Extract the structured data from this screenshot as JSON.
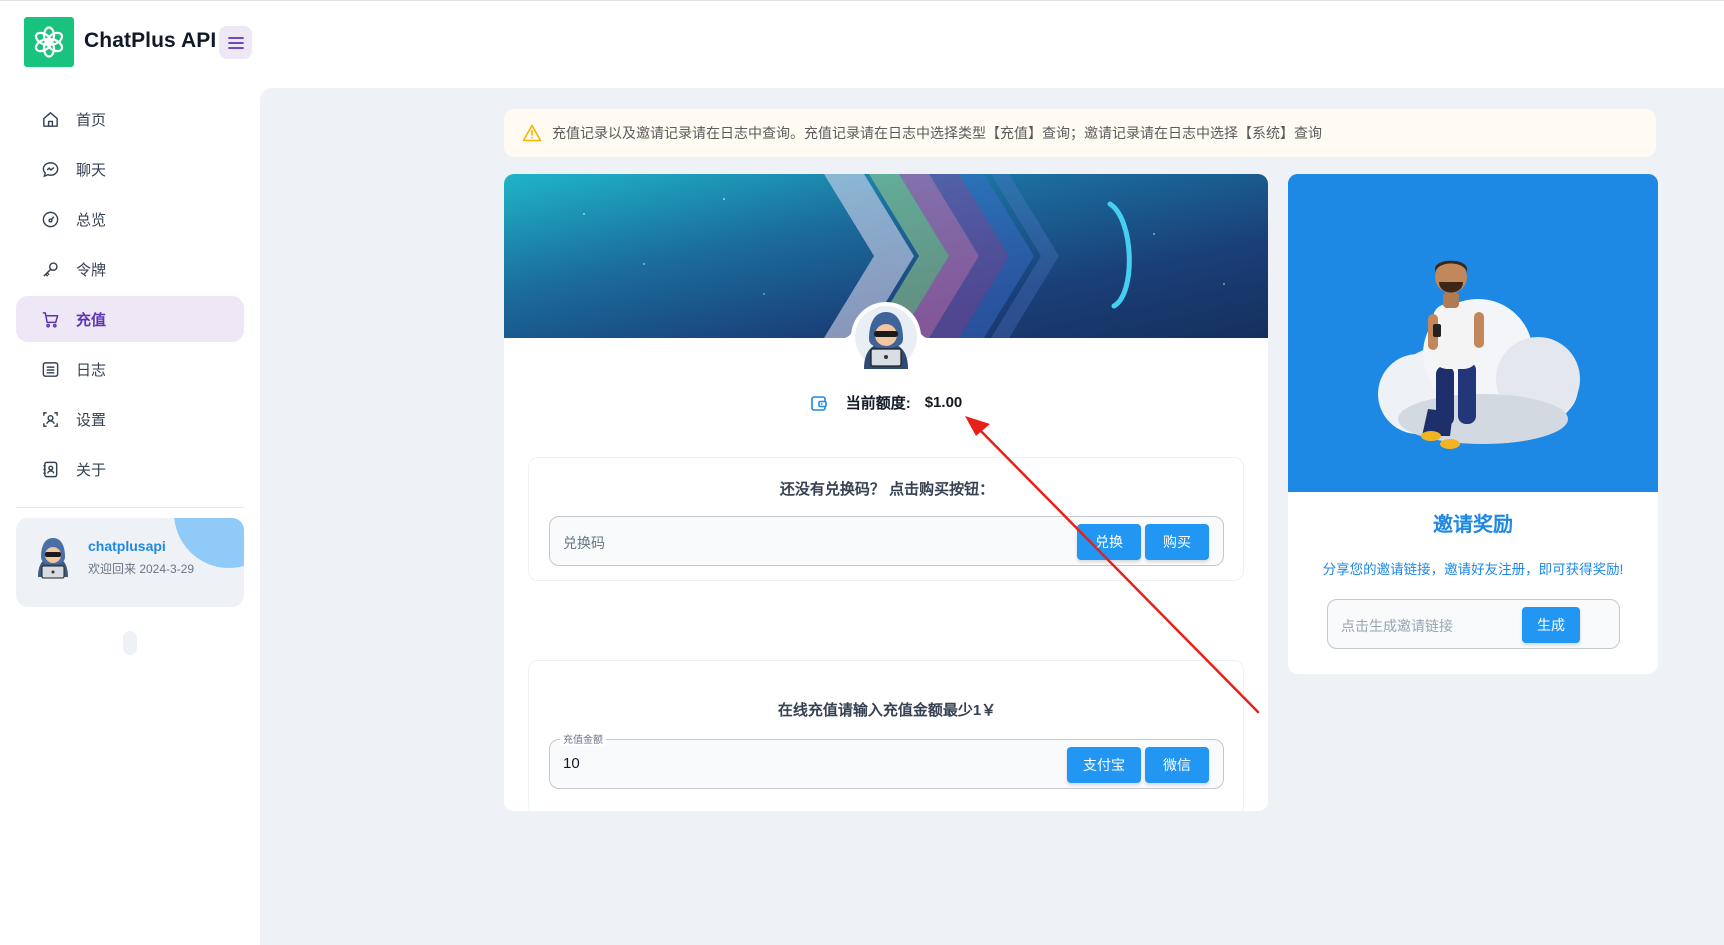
{
  "header": {
    "app_title": "ChatPlus API",
    "logo_icon": "openai-logo-icon",
    "menu_icon": "hamburger-icon"
  },
  "sidebar": {
    "items": [
      {
        "label": "首页",
        "icon": "home-icon",
        "active": false
      },
      {
        "label": "聊天",
        "icon": "chat-icon",
        "active": false
      },
      {
        "label": "总览",
        "icon": "gauge-icon",
        "active": false
      },
      {
        "label": "令牌",
        "icon": "key-icon",
        "active": false
      },
      {
        "label": "充值",
        "icon": "cart-icon",
        "active": true
      },
      {
        "label": "日志",
        "icon": "list-icon",
        "active": false
      },
      {
        "label": "设置",
        "icon": "settings-icon",
        "active": false
      },
      {
        "label": "关于",
        "icon": "address-book-icon",
        "active": false
      }
    ],
    "user": {
      "name": "chatplusapi",
      "welcome": "欢迎回来 2024-3-29"
    }
  },
  "alert": {
    "icon": "warning-icon",
    "text": "充值记录以及邀请记录请在日志中查询。充值记录请在日志中选择类型【充值】查询；邀请记录请在日志中选择【系统】查询"
  },
  "topup": {
    "balance_label": "当前额度:",
    "balance_value": "$1.00",
    "redeem": {
      "title": "还没有兑换码？ 点击购买按钮：",
      "placeholder": "兑换码",
      "redeem_label": "兑换",
      "buy_label": "购买"
    },
    "online": {
      "title": "在线充值请输入充值金额最少1￥",
      "field_legend": "充值金额",
      "amount": "10",
      "alipay_label": "支付宝",
      "wechat_label": "微信"
    }
  },
  "invite": {
    "title": "邀请奖励",
    "description": "分享您的邀请链接，邀请好友注册，即可获得奖励!",
    "placeholder": "点击生成邀请链接",
    "generate_label": "生成"
  },
  "colors": {
    "primary": "#2196f3",
    "accent_purple": "#5e35b1",
    "logo_green": "#19c37d",
    "annotation_red": "#e8201a"
  }
}
